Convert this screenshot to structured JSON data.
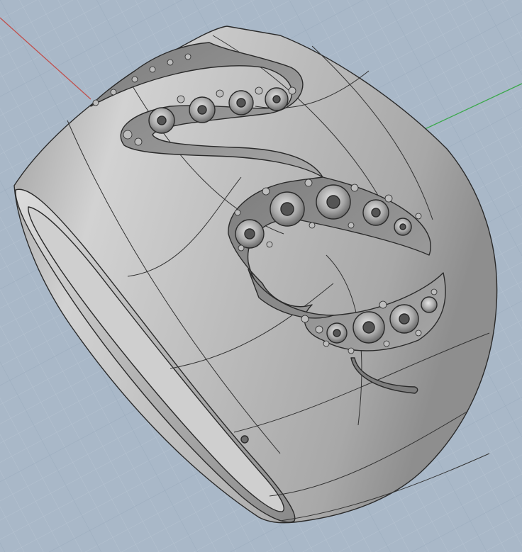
{
  "viewport": {
    "background": "#a9b8c8",
    "grid_minor_color": "#b7c4d2",
    "grid_major_color": "#98a8b9",
    "axis_x_color": "#c0504d",
    "axis_y_color": "#3aa84a"
  },
  "model": {
    "object": "ring",
    "shading": "#c4c4c4",
    "edge_color": "#2a2a2a",
    "stone_settings_visible": true
  }
}
